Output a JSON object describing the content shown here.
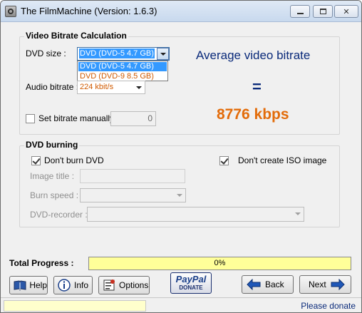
{
  "window": {
    "title": "The FilmMachine  (Version: 1.6.3)",
    "controls": [
      "minimize-icon",
      "maximize-icon",
      "close-icon"
    ],
    "close_glyph": "✕"
  },
  "bitrate": {
    "group_title": "Video Bitrate Calculation",
    "dvd_size_label": "DVD size :",
    "dvd_size_value": "DVD (DVD-5 4.7 GB)",
    "dvd_size_options": [
      "DVD (DVD-5 4.7 GB)",
      "DVD (DVD-9 8.5 GB)"
    ],
    "audio_bitrate_label": "Audio bitrate :",
    "audio_bitrate_value": "224 kbit/s",
    "manual_label": "Set bitrate manually",
    "manual_value": "0",
    "result_title": "Average video bitrate",
    "equals": "=",
    "result_value": "8776 kbps",
    "result_color": "#e36c0a"
  },
  "burning": {
    "group_title": "DVD burning",
    "dont_burn_label": "Don't burn DVD",
    "dont_create_iso_label": "Don't create ISO image",
    "image_title_label": "Image title :",
    "burn_speed_label": "Burn speed :",
    "recorder_label": "DVD-recorder :"
  },
  "progress": {
    "label": "Total Progress :",
    "percent_text": "0%",
    "value": 0
  },
  "buttons": {
    "help": "Help",
    "info": "Info",
    "options": "Options",
    "paypal_top": "PayPal",
    "paypal_bottom": "DONATE",
    "back": "Back",
    "next": "Next"
  },
  "status": {
    "right_text": "Please donate"
  }
}
